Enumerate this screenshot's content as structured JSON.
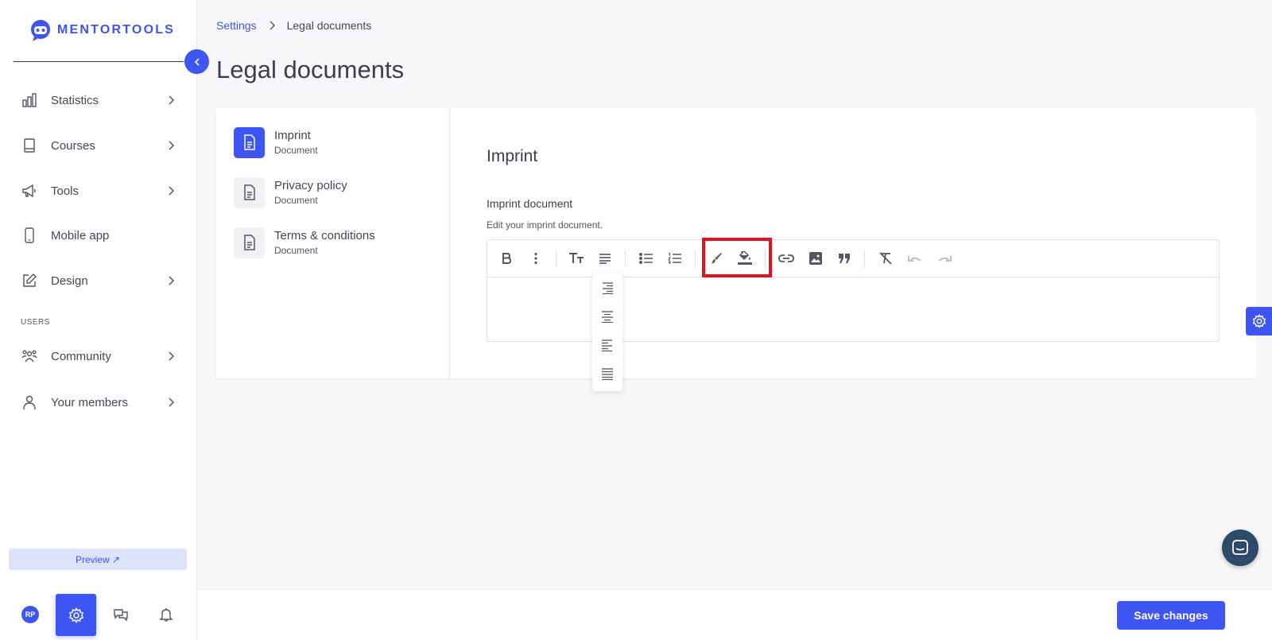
{
  "brand": {
    "name": "MENTORTOOLS",
    "accent": "#3d55f2"
  },
  "sidebar": {
    "items": [
      {
        "label": "Statistics",
        "icon": "bar-chart-icon",
        "has_submenu": true
      },
      {
        "label": "Courses",
        "icon": "book-icon",
        "has_submenu": true
      },
      {
        "label": "Tools",
        "icon": "megaphone-icon",
        "has_submenu": true
      },
      {
        "label": "Mobile app",
        "icon": "phone-icon",
        "has_submenu": false
      },
      {
        "label": "Design",
        "icon": "pencil-icon",
        "has_submenu": true
      }
    ],
    "users_section_label": "USERS",
    "user_items": [
      {
        "label": "Community",
        "icon": "community-icon",
        "has_submenu": true
      },
      {
        "label": "Your members",
        "icon": "person-icon",
        "has_submenu": true
      }
    ],
    "preview_label": "Preview ↗",
    "avatar_initials": "RP"
  },
  "breadcrumb": {
    "parent": "Settings",
    "current": "Legal documents"
  },
  "page": {
    "title": "Legal documents"
  },
  "documents": [
    {
      "title": "Imprint",
      "subtitle": "Document",
      "active": true
    },
    {
      "title": "Privacy policy",
      "subtitle": "Document",
      "active": false
    },
    {
      "title": "Terms & conditions",
      "subtitle": "Document",
      "active": false
    }
  ],
  "editor": {
    "heading": "Imprint",
    "field_label": "Imprint document",
    "field_help": "Edit your imprint document.",
    "content": "",
    "toolbar": [
      "bold-icon",
      "more-vertical-icon",
      "text-size-icon",
      "align-icon",
      "bullet-list-icon",
      "numbered-list-icon",
      "text-color-icon",
      "highlight-color-icon",
      "link-icon",
      "image-icon",
      "quote-icon",
      "clear-format-icon",
      "undo-icon",
      "redo-icon"
    ],
    "align_options": [
      "align-right-icon",
      "align-center-icon",
      "align-left-icon",
      "align-justify-icon"
    ]
  },
  "footer": {
    "save_label": "Save changes"
  }
}
